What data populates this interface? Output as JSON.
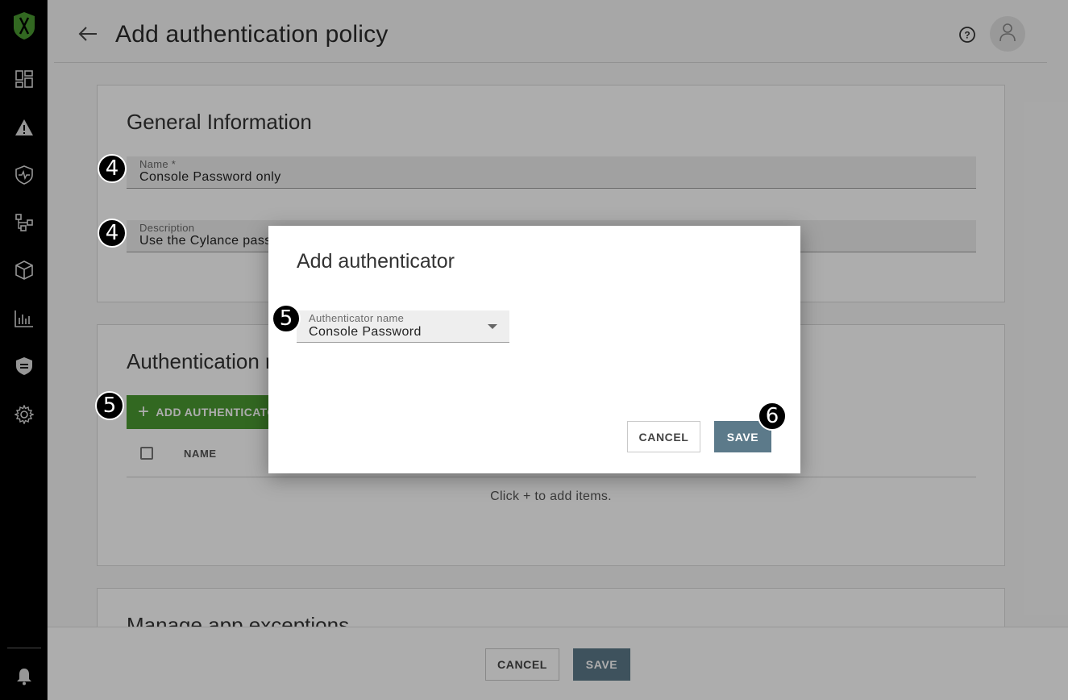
{
  "header": {
    "title": "Add authentication policy"
  },
  "general": {
    "section_title": "General Information",
    "name_label": "Name *",
    "name_value": "Console Password only",
    "description_label": "Description",
    "description_value": "Use the Cylance pass"
  },
  "auth_methods": {
    "section_title": "Authentication r",
    "add_button": "ADD AUTHENTICATO",
    "column_name": "NAME",
    "empty_message": "Click + to add items."
  },
  "exceptions": {
    "section_title": "Manage app exceptions"
  },
  "footer": {
    "cancel_label": "CANCEL",
    "save_label": "SAVE"
  },
  "modal": {
    "title": "Add authenticator",
    "field_label": "Authenticator name",
    "field_value": "Console Password",
    "cancel_label": "CANCEL",
    "save_label": "SAVE"
  },
  "callouts": [
    "4",
    "4",
    "5",
    "5",
    "6"
  ],
  "colors": {
    "sidebar_bg": "#000000",
    "brand_green": "#4a9a32",
    "save_button": "#5c7a8a",
    "badge_bg": "#000000"
  },
  "icons": {
    "sidebar": [
      "dashboard-icon",
      "alert-icon",
      "protection-icon",
      "network-icon",
      "assets-icon",
      "reports-icon",
      "policy-icon",
      "settings-icon",
      "bell-icon"
    ],
    "header": [
      "back-arrow-icon",
      "help-icon",
      "user-icon"
    ]
  }
}
